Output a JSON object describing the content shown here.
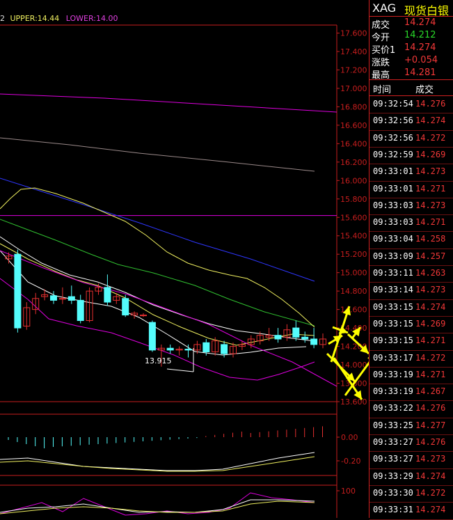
{
  "header": {
    "prefix": "2",
    "upper_label": "UPPER:14.44",
    "lower_label": "LOWER:14.00"
  },
  "colors": {
    "bg": "#000000",
    "axis_red": "#c81e1e",
    "candle_up": "#e53030",
    "candle_down": "#54fcfc",
    "ma_white": "#ffffff",
    "ma_yellow": "#f0f060",
    "ma_green": "#30c030",
    "ma_blue": "#2e36ff",
    "ma_magenta": "#e000e0",
    "ma_gray": "#9b8a8a",
    "arrow_yellow": "#ffff00",
    "quote_green": "#29d829",
    "quote_red": "#f43838"
  },
  "chart_data": {
    "type": "candlestick",
    "y_ticks": [
      "17.600",
      "17.400",
      "17.200",
      "17.000",
      "16.800",
      "16.600",
      "16.400",
      "16.200",
      "16.000",
      "15.800",
      "15.600",
      "15.400",
      "15.200",
      "15.000",
      "14.800",
      "14.600",
      "14.400",
      "14.200",
      "14.000",
      "13.800",
      "13.600"
    ],
    "ylim": [
      13.6,
      17.6
    ],
    "low_annotation": "13.915",
    "candles": [
      {
        "o": 15.15,
        "c": 15.18,
        "h": 15.22,
        "l": 15.1
      },
      {
        "o": 15.2,
        "c": 14.4,
        "h": 15.25,
        "l": 14.35
      },
      {
        "o": 14.42,
        "c": 14.62,
        "h": 14.68,
        "l": 14.38
      },
      {
        "o": 14.6,
        "c": 14.72,
        "h": 14.78,
        "l": 14.55
      },
      {
        "o": 14.74,
        "c": 14.76,
        "h": 14.82,
        "l": 14.7
      },
      {
        "o": 14.75,
        "c": 14.7,
        "h": 14.8,
        "l": 14.66
      },
      {
        "o": 14.72,
        "c": 14.72,
        "h": 14.84,
        "l": 14.66
      },
      {
        "o": 14.74,
        "c": 14.7,
        "h": 14.86,
        "l": 14.66
      },
      {
        "o": 14.7,
        "c": 14.48,
        "h": 14.76,
        "l": 14.45
      },
      {
        "o": 14.48,
        "c": 14.8,
        "h": 14.84,
        "l": 14.46
      },
      {
        "o": 14.8,
        "c": 14.84,
        "h": 14.88,
        "l": 14.76
      },
      {
        "o": 14.84,
        "c": 14.68,
        "h": 14.98,
        "l": 14.64
      },
      {
        "o": 14.7,
        "c": 14.74,
        "h": 14.78,
        "l": 14.66
      },
      {
        "o": 14.72,
        "c": 14.54,
        "h": 14.76,
        "l": 14.52
      },
      {
        "o": 14.54,
        "c": 14.56,
        "h": 14.58,
        "l": 14.5
      },
      {
        "o": 14.54,
        "c": 14.54,
        "h": 14.56,
        "l": 14.52
      },
      {
        "o": 14.46,
        "c": 14.16,
        "h": 14.48,
        "l": 14.14
      },
      {
        "o": 14.16,
        "c": 14.18,
        "h": 14.22,
        "l": 13.98
      },
      {
        "o": 14.18,
        "c": 14.16,
        "h": 14.22,
        "l": 14.12
      },
      {
        "o": 14.16,
        "c": 14.17,
        "h": 14.2,
        "l": 14.1
      },
      {
        "o": 14.17,
        "c": 14.16,
        "h": 14.22,
        "l": 14.08
      },
      {
        "o": 14.16,
        "c": 14.22,
        "h": 14.26,
        "l": 14.12
      },
      {
        "o": 14.24,
        "c": 14.14,
        "h": 14.28,
        "l": 14.1
      },
      {
        "o": 14.14,
        "c": 14.26,
        "h": 14.3,
        "l": 14.1
      },
      {
        "o": 14.22,
        "c": 14.12,
        "h": 14.26,
        "l": 14.08
      },
      {
        "o": 14.12,
        "c": 14.2,
        "h": 14.24,
        "l": 14.08
      },
      {
        "o": 14.2,
        "c": 14.22,
        "h": 14.26,
        "l": 14.16
      },
      {
        "o": 14.22,
        "c": 14.28,
        "h": 14.32,
        "l": 14.18
      },
      {
        "o": 14.26,
        "c": 14.32,
        "h": 14.36,
        "l": 14.22
      },
      {
        "o": 14.3,
        "c": 14.32,
        "h": 14.4,
        "l": 14.26
      },
      {
        "o": 14.32,
        "c": 14.28,
        "h": 14.4,
        "l": 14.24
      },
      {
        "o": 14.3,
        "c": 14.38,
        "h": 14.44,
        "l": 14.26
      },
      {
        "o": 14.4,
        "c": 14.3,
        "h": 14.48,
        "l": 14.26
      },
      {
        "o": 14.3,
        "c": 14.28,
        "h": 14.36,
        "l": 14.24
      },
      {
        "o": 14.28,
        "c": 14.22,
        "h": 14.4,
        "l": 14.18
      },
      {
        "o": 14.22,
        "c": 14.28,
        "h": 14.34,
        "l": 14.18
      }
    ],
    "macd_ticks": [
      "0.00",
      "-0.20"
    ],
    "kdj_ticks": [
      "100"
    ]
  },
  "quote": {
    "symbol": "XAG",
    "name": "现货白银",
    "rows": [
      {
        "label": "成交",
        "value": "14.274",
        "color": "#f43838"
      },
      {
        "label": "今开",
        "value": "14.212",
        "color": "#29d829"
      },
      {
        "label": "买价1",
        "value": "14.274",
        "color": "#f43838"
      },
      {
        "label": "涨跌",
        "value": "+0.054",
        "color": "#f43838"
      },
      {
        "label": "最高",
        "value": "14.281",
        "color": "#f43838"
      }
    ],
    "table_head": {
      "time": "时间",
      "price": "成交"
    },
    "ticks": [
      {
        "time": "09:32:54",
        "price": "14.276"
      },
      {
        "time": "09:32:56",
        "price": "14.274"
      },
      {
        "time": "09:32:56",
        "price": "14.272"
      },
      {
        "time": "09:32:59",
        "price": "14.269"
      },
      {
        "time": "09:33:01",
        "price": "14.273"
      },
      {
        "time": "09:33:01",
        "price": "14.271"
      },
      {
        "time": "09:33:03",
        "price": "14.273"
      },
      {
        "time": "09:33:03",
        "price": "14.271"
      },
      {
        "time": "09:33:04",
        "price": "14.258"
      },
      {
        "time": "09:33:09",
        "price": "14.257"
      },
      {
        "time": "09:33:11",
        "price": "14.263"
      },
      {
        "time": "09:33:14",
        "price": "14.273"
      },
      {
        "time": "09:33:15",
        "price": "14.274"
      },
      {
        "time": "09:33:15",
        "price": "14.269"
      },
      {
        "time": "09:33:15",
        "price": "14.271"
      },
      {
        "time": "09:33:17",
        "price": "14.272"
      },
      {
        "time": "09:33:19",
        "price": "14.271"
      },
      {
        "time": "09:33:19",
        "price": "14.267"
      },
      {
        "time": "09:33:22",
        "price": "14.276"
      },
      {
        "time": "09:33:25",
        "price": "14.277"
      },
      {
        "time": "09:33:27",
        "price": "14.276"
      },
      {
        "time": "09:33:27",
        "price": "14.273"
      },
      {
        "time": "09:33:29",
        "price": "14.274"
      },
      {
        "time": "09:33:30",
        "price": "14.272"
      },
      {
        "time": "09:33:31",
        "price": "14.274"
      }
    ]
  }
}
